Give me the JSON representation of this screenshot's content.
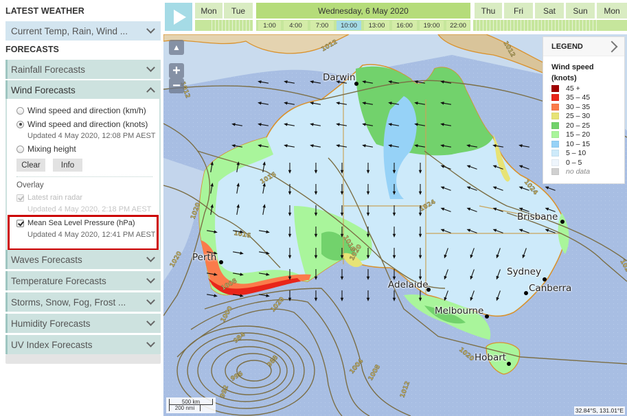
{
  "sidebar": {
    "latest_title": "LATEST WEATHER",
    "latest_item": "Current Temp, Rain, Wind ...",
    "forecasts_title": "FORECASTS",
    "rainfall": "Rainfall Forecasts",
    "wind": {
      "label": "Wind Forecasts",
      "options": [
        {
          "label": "Wind speed and direction (km/h)",
          "selected": false
        },
        {
          "label": "Wind speed and direction (knots)",
          "selected": true
        },
        {
          "label": "Mixing height",
          "selected": false
        }
      ],
      "knots_updated": "Updated 4 May 2020, 12:08 PM AEST",
      "clear_label": "Clear",
      "info_label": "Info",
      "overlay_title": "Overlay",
      "overlays": [
        {
          "label": "Latest rain radar",
          "updated": "Updated 4 May 2020, 2:18 PM AEST",
          "checked": true,
          "disabled": true
        },
        {
          "label": "Mean Sea Level Pressure (hPa)",
          "updated": "Updated 4 May 2020, 12:41 PM AEST",
          "checked": true,
          "disabled": false
        }
      ]
    },
    "others": [
      "Waves Forecasts",
      "Temperature Forecasts",
      "Storms, Snow, Fog, Frost ...",
      "Humidity Forecasts",
      "UV Index Forecasts"
    ]
  },
  "timeline": {
    "days_before": [
      "Mon",
      "Tue"
    ],
    "selected_day": "Wednesday, 6 May 2020",
    "days_after": [
      "Thu",
      "Fri",
      "Sat",
      "Sun",
      "Mon"
    ],
    "hours": [
      "1:00",
      "4:00",
      "7:00",
      "10:00",
      "13:00",
      "16:00",
      "19:00",
      "22:00"
    ],
    "selected_hour": "10:00"
  },
  "legend": {
    "title": "LEGEND",
    "subtitle_1": "Wind speed",
    "subtitle_2": "(knots)",
    "items": [
      {
        "label": "45 +",
        "color": "#a00000"
      },
      {
        "label": "35 – 45",
        "color": "#e8251a"
      },
      {
        "label": "30 – 35",
        "color": "#fb7b4b"
      },
      {
        "label": "25 – 30",
        "color": "#e7e375"
      },
      {
        "label": "20 – 25",
        "color": "#72d26c"
      },
      {
        "label": "15 – 20",
        "color": "#a9f59b"
      },
      {
        "label": "10 – 15",
        "color": "#96d2f7"
      },
      {
        "label": "5 – 10",
        "color": "#cdeafa"
      },
      {
        "label": "0 – 5",
        "color": "#eef5fc"
      },
      {
        "label": "no data",
        "color": "#d0d0d0"
      }
    ]
  },
  "map": {
    "cities": [
      "Darwin",
      "Brisbane",
      "Perth",
      "Sydney",
      "Canberra",
      "Adelaide",
      "Melbourne",
      "Hobart"
    ],
    "isobars": [
      "1012",
      "1012",
      "1012",
      "1016",
      "1016",
      "1016",
      "1020",
      "1020",
      "1020",
      "1020",
      "1024",
      "1024",
      "1008",
      "1004",
      "1000",
      "996",
      "992",
      "988",
      "984",
      "1012",
      "1008",
      "1020",
      "1020"
    ],
    "scale_km": "500 km",
    "scale_nmi": "200 nmi",
    "coords": "32.84°S, 131.01°E"
  }
}
